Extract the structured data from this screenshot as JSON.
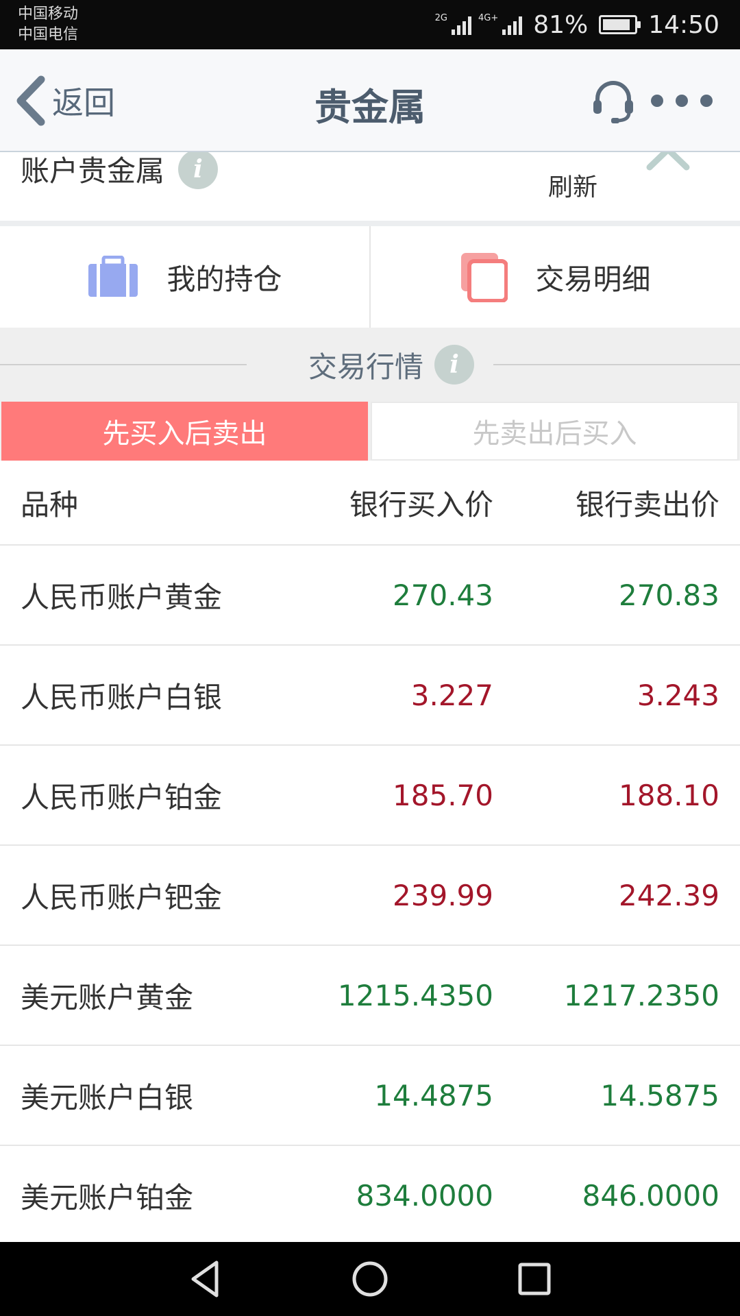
{
  "status_bar": {
    "carrier1": "中国移动",
    "carrier2": "中国电信",
    "net1": "2G",
    "net2": "4G+",
    "battery": "81%",
    "time": "14:50"
  },
  "header": {
    "back_label": "返回",
    "title": "贵金属"
  },
  "account": {
    "title": "账户贵金属",
    "info_glyph": "i",
    "refresh_label": "刷新"
  },
  "actions": {
    "holdings": "我的持仓",
    "details": "交易明细"
  },
  "section": {
    "title": "交易行情",
    "info_glyph": "i"
  },
  "tabs": {
    "buy_first": "先买入后卖出",
    "sell_first": "先卖出后买入"
  },
  "table": {
    "headers": {
      "name": "品种",
      "buy": "银行买入价",
      "sell": "银行卖出价"
    },
    "rows": [
      {
        "name": "人民币账户黄金",
        "buy": "270.43",
        "sell": "270.83",
        "trend": "up"
      },
      {
        "name": "人民币账户白银",
        "buy": "3.227",
        "sell": "3.243",
        "trend": "down"
      },
      {
        "name": "人民币账户铂金",
        "buy": "185.70",
        "sell": "188.10",
        "trend": "down"
      },
      {
        "name": "人民币账户钯金",
        "buy": "239.99",
        "sell": "242.39",
        "trend": "down"
      },
      {
        "name": "美元账户黄金",
        "buy": "1215.4350",
        "sell": "1217.2350",
        "trend": "up"
      },
      {
        "name": "美元账户白银",
        "buy": "14.4875",
        "sell": "14.5875",
        "trend": "up"
      },
      {
        "name": "美元账户铂金",
        "buy": "834.0000",
        "sell": "846.0000",
        "trend": "up"
      }
    ]
  },
  "colors": {
    "price_up": "#1e7d3c",
    "price_down": "#a3162a",
    "tab_active": "#ff7a7a",
    "header_text": "#4c5c6d"
  },
  "icons": {
    "back": "chevron-left-icon",
    "customer_service": "headset-icon",
    "more": "more-dots-icon",
    "holdings": "briefcase-icon",
    "details": "copy-icon",
    "info": "info-icon",
    "collapse": "chevron-up-icon"
  }
}
